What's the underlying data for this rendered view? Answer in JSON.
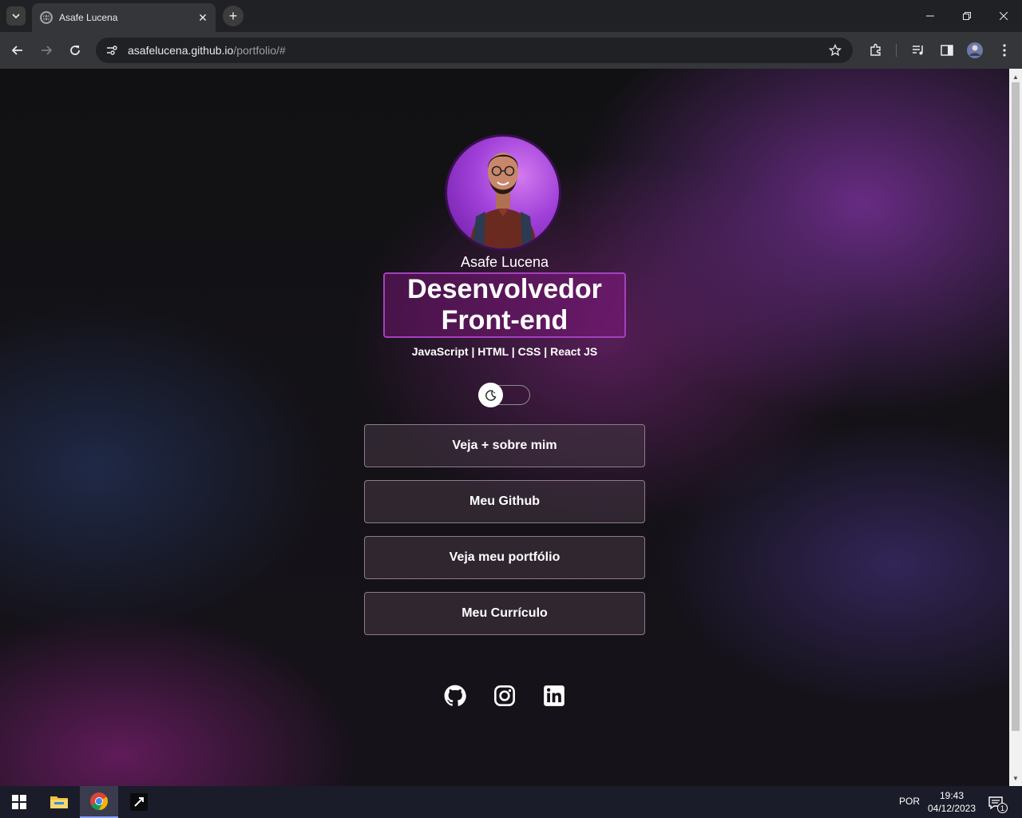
{
  "browser": {
    "tab_title": "Asafe Lucena",
    "new_tab_symbol": "+",
    "close_symbol": "✕",
    "url_host": "asafelucena.github.io",
    "url_path": "/portfolio/#"
  },
  "profile": {
    "name": "Asafe Lucena",
    "role_line1": "Desenvolvedor",
    "role_line2": "Front-end",
    "skills": "JavaScript | HTML | CSS | React JS"
  },
  "links": [
    {
      "label": "Veja + sobre mim"
    },
    {
      "label": "Meu Github"
    },
    {
      "label": "Veja meu portfólio"
    },
    {
      "label": "Meu Currículo"
    }
  ],
  "social": [
    "github-icon",
    "instagram-icon",
    "linkedin-icon"
  ],
  "taskbar": {
    "language": "POR",
    "time": "19:43",
    "date": "04/12/2023",
    "notification_count": "1"
  },
  "colors": {
    "accent": "#a43fbf",
    "chrome_dark": "#202124",
    "chrome_toolbar": "#35363a",
    "taskbar": "#1b1c29"
  }
}
